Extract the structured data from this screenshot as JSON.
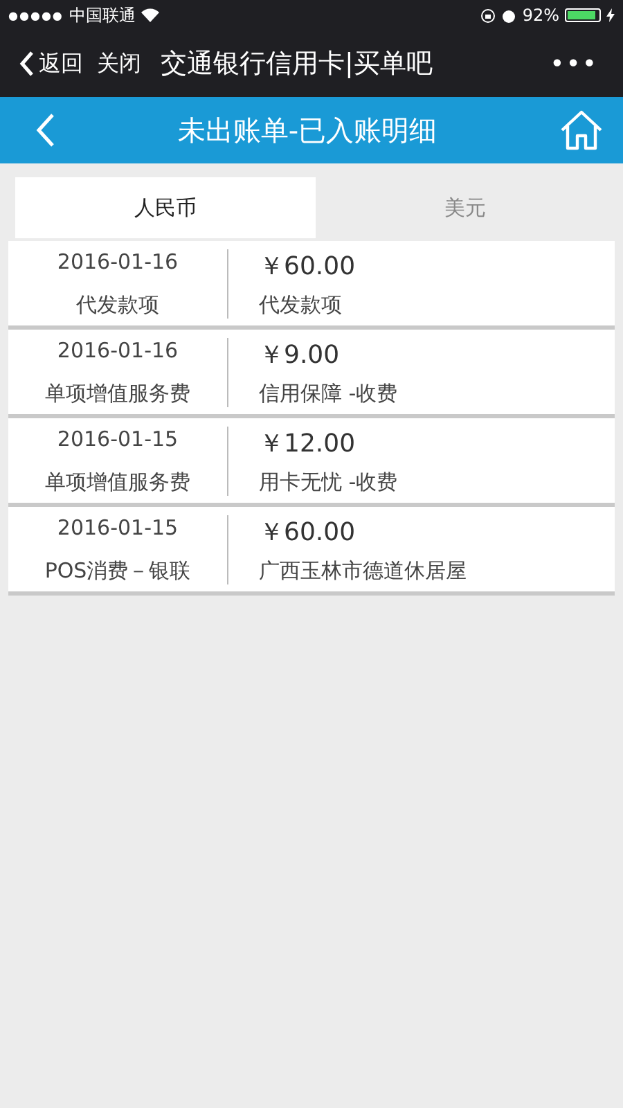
{
  "status_bar": {
    "signal_dots": "●●●●●",
    "carrier": "中国联通",
    "battery": "92%",
    "battery_meter": {
      "level": 0.92
    }
  },
  "wechat_bar": {
    "back": "返回",
    "close": "关闭",
    "title": "交通银行信用卡|买单吧",
    "more": "•••"
  },
  "header": {
    "title": "未出账单-已入账明细"
  },
  "tabs": [
    {
      "label": "人民币",
      "selected": true
    },
    {
      "label": "美元",
      "selected": false
    }
  ],
  "transactions": [
    {
      "date": "2016-01-16",
      "type": "代发款项",
      "amount": "￥60.00",
      "description": "代发款项"
    },
    {
      "date": "2016-01-16",
      "type": "单项增值服务费",
      "amount": "￥9.00",
      "description": "信用保障 -收费"
    },
    {
      "date": "2016-01-15",
      "type": "单项增值服务费",
      "amount": "￥12.00",
      "description": "用卡无忧 -收费"
    },
    {
      "date": "2016-01-15",
      "type": "POS消费－银联",
      "amount": "￥60.00",
      "description": "广西玉林市德道休居屋"
    }
  ]
}
